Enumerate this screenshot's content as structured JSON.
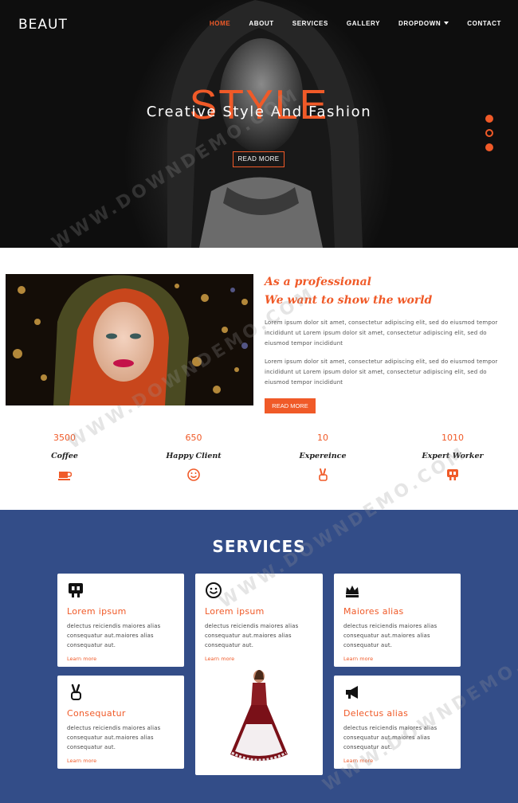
{
  "header": {
    "brand": "BEAUT",
    "nav": [
      {
        "label": "HOME",
        "active": true
      },
      {
        "label": "ABOUT"
      },
      {
        "label": "SERVICES"
      },
      {
        "label": "GALLERY"
      },
      {
        "label": "DROPDOWN"
      },
      {
        "label": "CONTACT"
      }
    ]
  },
  "hero": {
    "big_text": "STYLE",
    "title": "Creative Style And Fashion",
    "button": "READ MORE",
    "slides": 3,
    "active_slide": 2
  },
  "about": {
    "heading_line1": "As a professional",
    "heading_line2": "We want to show the world",
    "paragraph1": "Lorem ipsum dolor sit amet, consectetur adipiscing elit, sed do eiusmod tempor incididunt ut Lorem ipsum dolor sit amet, consectetur adipiscing elit, sed do eiusmod tempor incididunt",
    "paragraph2": "Lorem ipsum dolor sit amet, consectetur adipiscing elit, sed do eiusmod tempor incididunt ut Lorem ipsum dolor sit amet, consectetur adipiscing elit, sed do eiusmod tempor incididunt",
    "button": "READ MORE"
  },
  "stats": [
    {
      "value": "3500",
      "label": "Coffee",
      "icon": "coffee-cup-icon"
    },
    {
      "value": "650",
      "label": "Happy Client",
      "icon": "smiley-icon"
    },
    {
      "value": "10",
      "label": "Expereince",
      "icon": "peace-hand-icon"
    },
    {
      "value": "1010",
      "label": "Expert Worker",
      "icon": "worker-icon"
    }
  ],
  "services": {
    "title": "SERVICES",
    "cards": [
      {
        "title": "Lorem ipsum",
        "text": "delectus reiciendis maiores alias consequatur aut.maiores alias consequatur aut.",
        "link": "Learn more",
        "icon": "worker-icon"
      },
      {
        "title": "Lorem ipsum",
        "text": "delectus reiciendis maiores alias consequatur aut.maiores alias consequatur aut.",
        "link": "Learn more",
        "icon": "smiley-icon"
      },
      {
        "title": "Maiores alias",
        "text": "delectus reiciendis maiores alias consequatur aut.maiores alias consequatur aut.",
        "link": "Learn more",
        "icon": "crown-icon"
      },
      {
        "title": "Consequatur",
        "text": "delectus reiciendis maiores alias consequatur aut.maiores alias consequatur aut.",
        "link": "Learn more",
        "icon": "peace-hand-icon"
      },
      {
        "title": "Delectus alias",
        "text": "delectus reiciendis maiores alias consequatur aut.maiores alias consequatur aut.",
        "link": "Learn more",
        "icon": "megaphone-icon"
      }
    ]
  },
  "watermark": "WWW.DOWNDEMO.COM",
  "colors": {
    "accent": "#f05a28",
    "services_bg": "#334d88",
    "hero_bg": "#111111"
  }
}
